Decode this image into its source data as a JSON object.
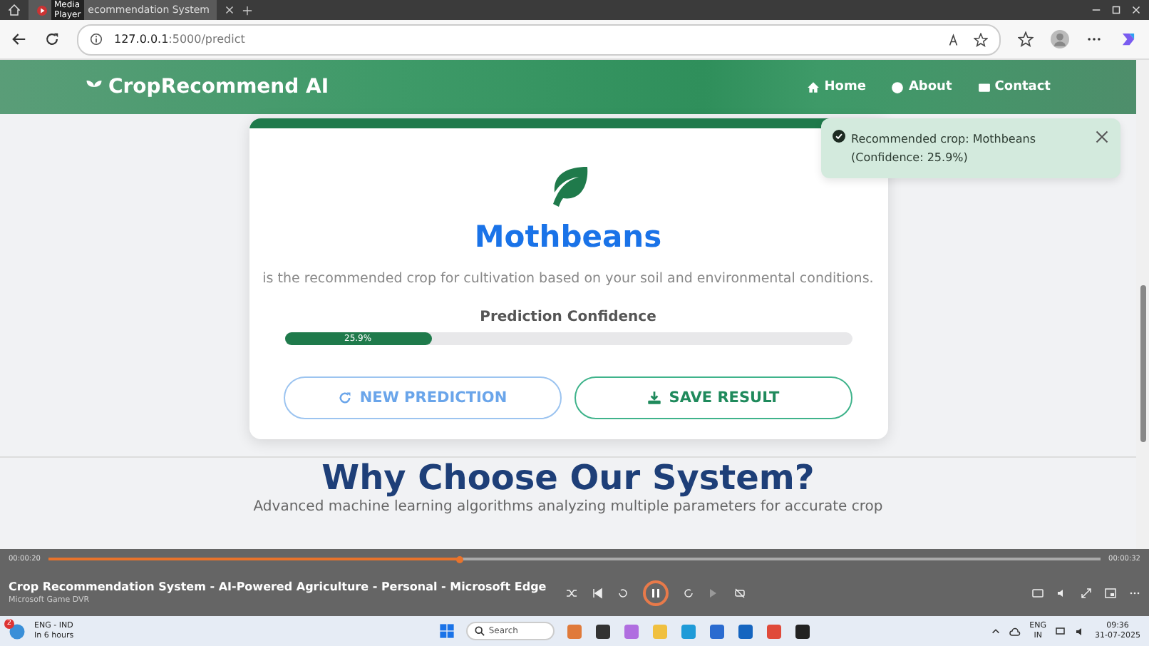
{
  "browser": {
    "tooltip": "Media Player",
    "tab_title": "ecommendation System",
    "url_host": "127.0.0.1",
    "url_path": ":5000/predict"
  },
  "navbar": {
    "brand": "CropRecommend AI",
    "links": [
      {
        "label": "Home"
      },
      {
        "label": "About"
      },
      {
        "label": "Contact"
      }
    ]
  },
  "result": {
    "crop": "Mothbeans",
    "description": "is the recommended crop for cultivation based on your soil and environmental conditions.",
    "confidence_label": "Prediction Confidence",
    "confidence": {
      "level": 0.259,
      "reading": "25.9%"
    },
    "buttons": [
      {
        "kind": "refresh",
        "label": "NEW PREDICTION"
      },
      {
        "kind": "download",
        "label": "SAVE RESULT"
      }
    ]
  },
  "toast": {
    "line1": "Recommended crop: Mothbeans",
    "line2": "(Confidence: 25.9%)"
  },
  "section": {
    "heading": "Why Choose Our System?",
    "subtitle": "Advanced machine learning algorithms analyzing multiple parameters for accurate crop"
  },
  "player": {
    "elapsed": "00:00:20",
    "total": "00:00:32",
    "progress": {
      "level": 0.39
    },
    "title": "Crop Recommendation System - AI-Powered Agriculture - Personal - Microsoft Edge",
    "source": "Microsoft Game DVR"
  },
  "taskbar": {
    "weather_title": "ENG - IND",
    "weather_sub": "In 6 hours",
    "notification_count": "2",
    "search": "Search",
    "lang1": "ENG",
    "lang2": "IN",
    "time": "09:36",
    "date": "31-07-2025"
  }
}
